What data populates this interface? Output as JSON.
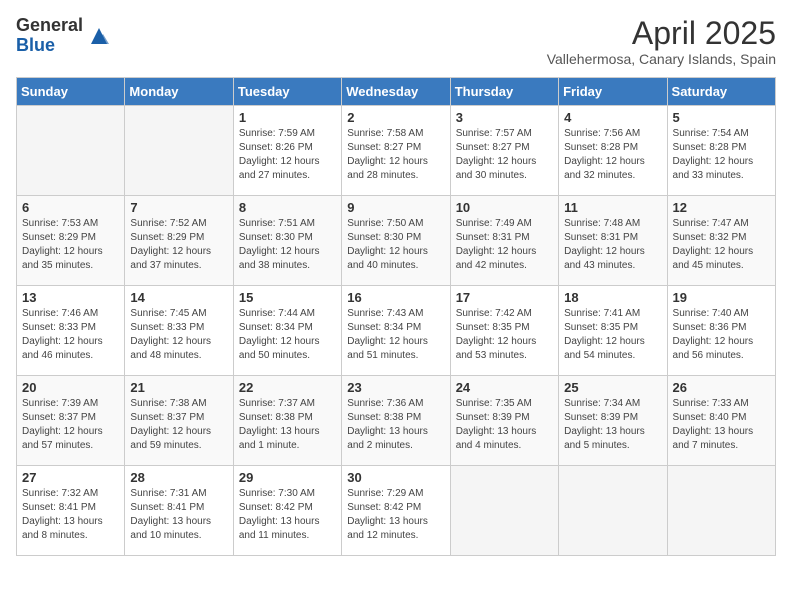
{
  "header": {
    "logo_general": "General",
    "logo_blue": "Blue",
    "title": "April 2025",
    "subtitle": "Vallehermosa, Canary Islands, Spain"
  },
  "days_of_week": [
    "Sunday",
    "Monday",
    "Tuesday",
    "Wednesday",
    "Thursday",
    "Friday",
    "Saturday"
  ],
  "weeks": [
    [
      {
        "day": "",
        "content": ""
      },
      {
        "day": "",
        "content": ""
      },
      {
        "day": "1",
        "content": "Sunrise: 7:59 AM\nSunset: 8:26 PM\nDaylight: 12 hours and 27 minutes."
      },
      {
        "day": "2",
        "content": "Sunrise: 7:58 AM\nSunset: 8:27 PM\nDaylight: 12 hours and 28 minutes."
      },
      {
        "day": "3",
        "content": "Sunrise: 7:57 AM\nSunset: 8:27 PM\nDaylight: 12 hours and 30 minutes."
      },
      {
        "day": "4",
        "content": "Sunrise: 7:56 AM\nSunset: 8:28 PM\nDaylight: 12 hours and 32 minutes."
      },
      {
        "day": "5",
        "content": "Sunrise: 7:54 AM\nSunset: 8:28 PM\nDaylight: 12 hours and 33 minutes."
      }
    ],
    [
      {
        "day": "6",
        "content": "Sunrise: 7:53 AM\nSunset: 8:29 PM\nDaylight: 12 hours and 35 minutes."
      },
      {
        "day": "7",
        "content": "Sunrise: 7:52 AM\nSunset: 8:29 PM\nDaylight: 12 hours and 37 minutes."
      },
      {
        "day": "8",
        "content": "Sunrise: 7:51 AM\nSunset: 8:30 PM\nDaylight: 12 hours and 38 minutes."
      },
      {
        "day": "9",
        "content": "Sunrise: 7:50 AM\nSunset: 8:30 PM\nDaylight: 12 hours and 40 minutes."
      },
      {
        "day": "10",
        "content": "Sunrise: 7:49 AM\nSunset: 8:31 PM\nDaylight: 12 hours and 42 minutes."
      },
      {
        "day": "11",
        "content": "Sunrise: 7:48 AM\nSunset: 8:31 PM\nDaylight: 12 hours and 43 minutes."
      },
      {
        "day": "12",
        "content": "Sunrise: 7:47 AM\nSunset: 8:32 PM\nDaylight: 12 hours and 45 minutes."
      }
    ],
    [
      {
        "day": "13",
        "content": "Sunrise: 7:46 AM\nSunset: 8:33 PM\nDaylight: 12 hours and 46 minutes."
      },
      {
        "day": "14",
        "content": "Sunrise: 7:45 AM\nSunset: 8:33 PM\nDaylight: 12 hours and 48 minutes."
      },
      {
        "day": "15",
        "content": "Sunrise: 7:44 AM\nSunset: 8:34 PM\nDaylight: 12 hours and 50 minutes."
      },
      {
        "day": "16",
        "content": "Sunrise: 7:43 AM\nSunset: 8:34 PM\nDaylight: 12 hours and 51 minutes."
      },
      {
        "day": "17",
        "content": "Sunrise: 7:42 AM\nSunset: 8:35 PM\nDaylight: 12 hours and 53 minutes."
      },
      {
        "day": "18",
        "content": "Sunrise: 7:41 AM\nSunset: 8:35 PM\nDaylight: 12 hours and 54 minutes."
      },
      {
        "day": "19",
        "content": "Sunrise: 7:40 AM\nSunset: 8:36 PM\nDaylight: 12 hours and 56 minutes."
      }
    ],
    [
      {
        "day": "20",
        "content": "Sunrise: 7:39 AM\nSunset: 8:37 PM\nDaylight: 12 hours and 57 minutes."
      },
      {
        "day": "21",
        "content": "Sunrise: 7:38 AM\nSunset: 8:37 PM\nDaylight: 12 hours and 59 minutes."
      },
      {
        "day": "22",
        "content": "Sunrise: 7:37 AM\nSunset: 8:38 PM\nDaylight: 13 hours and 1 minute."
      },
      {
        "day": "23",
        "content": "Sunrise: 7:36 AM\nSunset: 8:38 PM\nDaylight: 13 hours and 2 minutes."
      },
      {
        "day": "24",
        "content": "Sunrise: 7:35 AM\nSunset: 8:39 PM\nDaylight: 13 hours and 4 minutes."
      },
      {
        "day": "25",
        "content": "Sunrise: 7:34 AM\nSunset: 8:39 PM\nDaylight: 13 hours and 5 minutes."
      },
      {
        "day": "26",
        "content": "Sunrise: 7:33 AM\nSunset: 8:40 PM\nDaylight: 13 hours and 7 minutes."
      }
    ],
    [
      {
        "day": "27",
        "content": "Sunrise: 7:32 AM\nSunset: 8:41 PM\nDaylight: 13 hours and 8 minutes."
      },
      {
        "day": "28",
        "content": "Sunrise: 7:31 AM\nSunset: 8:41 PM\nDaylight: 13 hours and 10 minutes."
      },
      {
        "day": "29",
        "content": "Sunrise: 7:30 AM\nSunset: 8:42 PM\nDaylight: 13 hours and 11 minutes."
      },
      {
        "day": "30",
        "content": "Sunrise: 7:29 AM\nSunset: 8:42 PM\nDaylight: 13 hours and 12 minutes."
      },
      {
        "day": "",
        "content": ""
      },
      {
        "day": "",
        "content": ""
      },
      {
        "day": "",
        "content": ""
      }
    ]
  ]
}
